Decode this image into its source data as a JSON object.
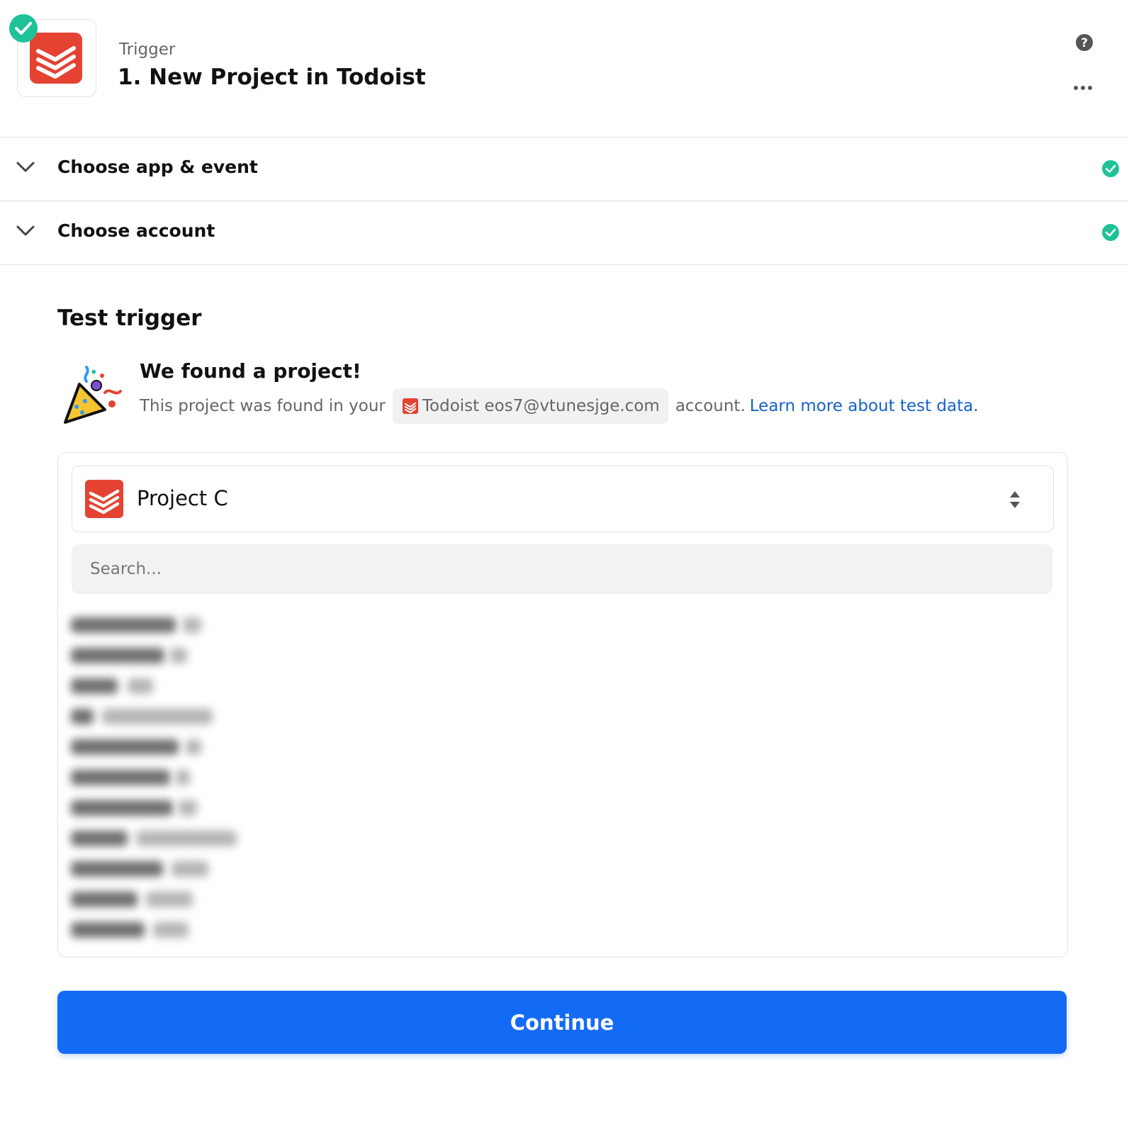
{
  "colors": {
    "todoist_red": "#e44332",
    "success_green": "#1ec299",
    "link_blue": "#1563c8",
    "primary_button": "#136bf5"
  },
  "header": {
    "step_type": "Trigger",
    "title": "1. New Project in Todoist",
    "app_icon": "todoist-logo",
    "status_icon": "check-circle-icon",
    "help_icon": "question-circle-icon",
    "more_icon": "more-horizontal-icon"
  },
  "accordion": [
    {
      "label": "Choose app & event",
      "status_icon": "check-circle-icon"
    },
    {
      "label": "Choose account",
      "status_icon": "check-circle-icon"
    }
  ],
  "test": {
    "section_title": "Test trigger",
    "found_title": "We found a project!",
    "found_text_before": "This project was found in your",
    "account_chip": "Todoist eos7@vtunesjge.com",
    "found_text_after": "account.",
    "learn_more_link": "Learn more about test data."
  },
  "project_select": {
    "selected_value": "Project C",
    "search_placeholder": "Search..."
  },
  "continue_label": "Continue"
}
